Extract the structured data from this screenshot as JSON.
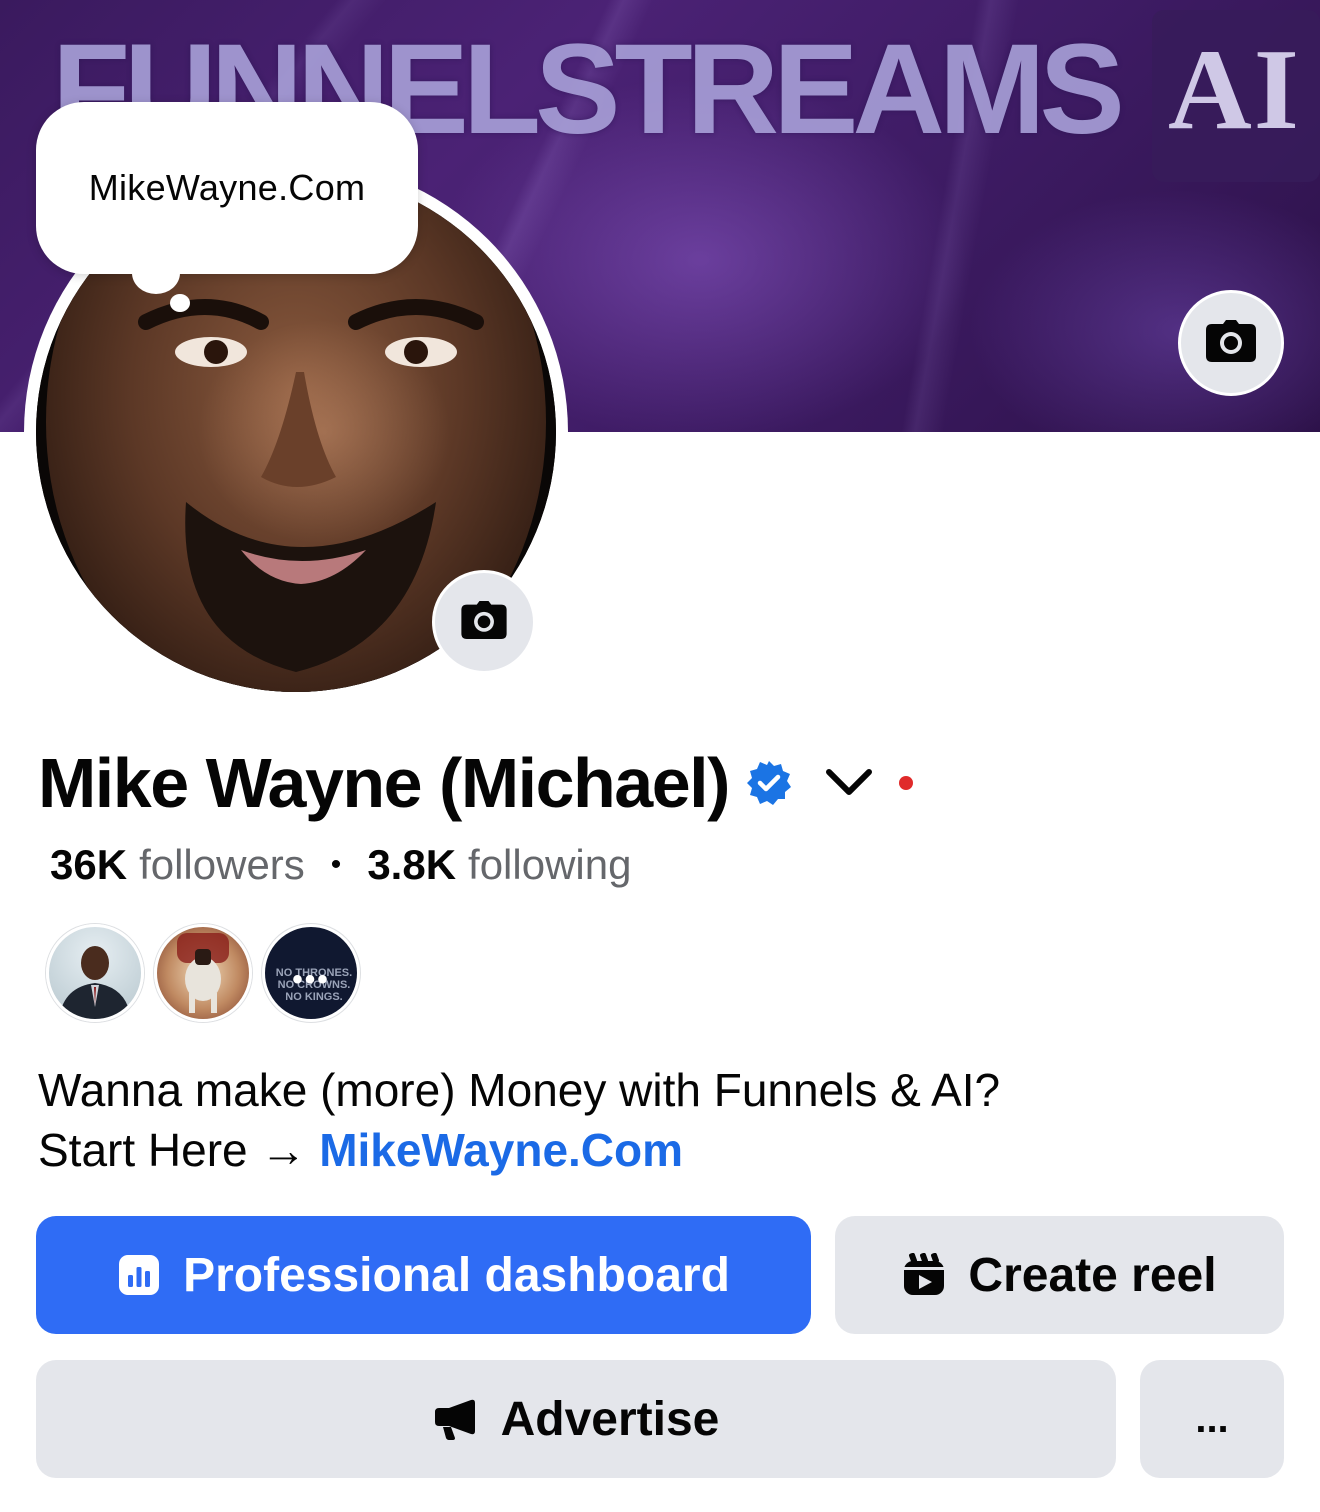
{
  "cover": {
    "brand_text": "FUNNELSTREAMS",
    "brand_ai": "AI",
    "camera_icon": "camera-icon"
  },
  "thought_bubble": {
    "text": "MikeWayne.Com"
  },
  "profile": {
    "name": "Mike Wayne (Michael)",
    "verified_icon": "verified-badge-icon",
    "dropdown_icon": "chevron-down-icon",
    "status_dot_color": "#e02a2a",
    "avatar_camera_icon": "camera-icon"
  },
  "stats": {
    "followers_count": "36K",
    "followers_label": "followers",
    "separator": "•",
    "following_count": "3.8K",
    "following_label": "following"
  },
  "mutual_avatars": {
    "more_indicator": "•••",
    "third_avatar_text": "NO THRONES. NO CROWNS. NO KINGS."
  },
  "bio": {
    "line1": "Wanna make (more) Money with Funnels & AI?",
    "line2_prefix": "Start Here → ",
    "link_text": "MikeWayne.Com"
  },
  "actions": {
    "professional_dashboard": "Professional dashboard",
    "create_reel": "Create reel",
    "advertise": "Advertise",
    "more": "..."
  },
  "colors": {
    "primary": "#2f6cf5",
    "secondary_button": "#e4e6eb",
    "link": "#1b6ae6",
    "muted_text": "#65676b"
  }
}
